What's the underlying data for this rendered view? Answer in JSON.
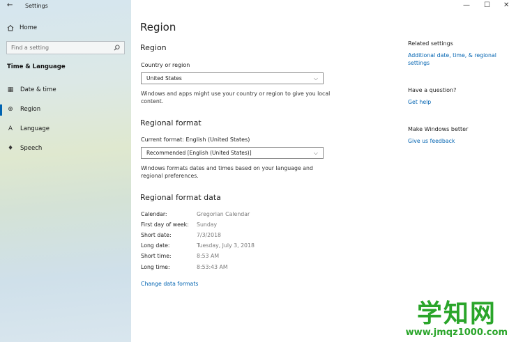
{
  "window": {
    "title": "Settings",
    "back_glyph": "←",
    "minimize_glyph": "—",
    "maximize_glyph": "☐",
    "close_glyph": "✕"
  },
  "sidebar": {
    "home_label": "Home",
    "search_placeholder": "Find a setting",
    "section_title": "Time & Language",
    "items": [
      {
        "label": "Date & time",
        "icon": "calendar-icon",
        "glyph": "▦"
      },
      {
        "label": "Region",
        "icon": "globe-icon",
        "glyph": "⊕"
      },
      {
        "label": "Language",
        "icon": "language-icon",
        "glyph": "A"
      },
      {
        "label": "Speech",
        "icon": "microphone-icon",
        "glyph": "♦"
      }
    ],
    "active_index": 1
  },
  "main": {
    "page_title": "Region",
    "region_heading": "Region",
    "country_label": "Country or region",
    "country_value": "United States",
    "country_desc": "Windows and apps might use your country or region to give you local content.",
    "format_heading": "Regional format",
    "current_format_label": "Current format: English (United States)",
    "format_value": "Recommended [English (United States)]",
    "format_desc": "Windows formats dates and times based on your language and regional preferences.",
    "data_heading": "Regional format data",
    "data_rows": [
      {
        "key": "Calendar:",
        "value": "Gregorian Calendar"
      },
      {
        "key": "First day of week:",
        "value": "Sunday"
      },
      {
        "key": "Short date:",
        "value": "7/3/2018"
      },
      {
        "key": "Long date:",
        "value": "Tuesday, July 3, 2018"
      },
      {
        "key": "Short time:",
        "value": "8:53 AM"
      },
      {
        "key": "Long time:",
        "value": "8:53:43 AM"
      }
    ],
    "change_link": "Change data formats"
  },
  "right": {
    "related_title": "Related settings",
    "related_link": "Additional date, time, & regional settings",
    "question_title": "Have a question?",
    "help_link": "Get help",
    "better_title": "Make Windows better",
    "feedback_link": "Give us feedback"
  },
  "watermark": {
    "big": "学知网",
    "small": "www.jmqz1000.com"
  },
  "colors": {
    "accent": "#0063b1",
    "watermark": "#2aa52a"
  }
}
